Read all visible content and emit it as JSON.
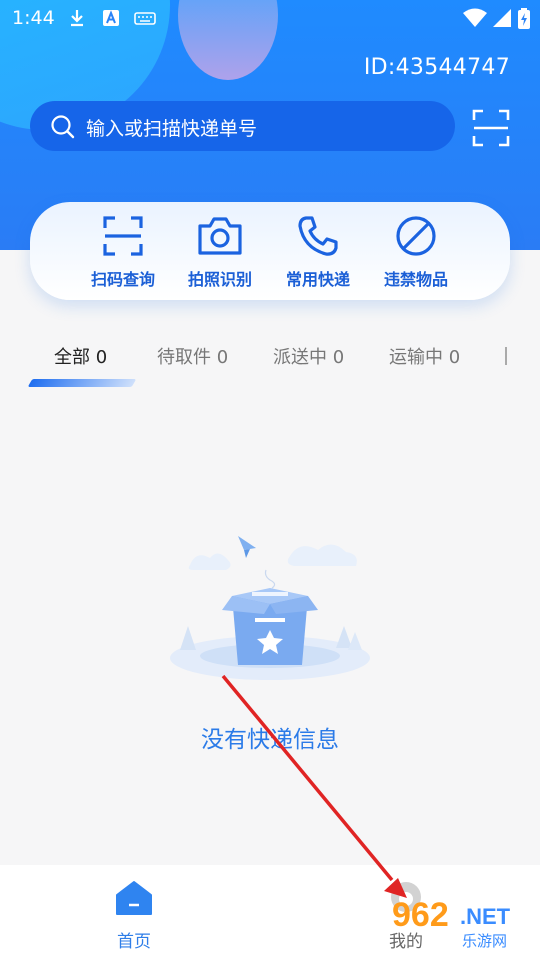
{
  "status": {
    "time": "1:44"
  },
  "header": {
    "user_id": "ID:43544747"
  },
  "search": {
    "placeholder": "输入或扫描快递单号"
  },
  "actions": [
    {
      "label": "扫码查询",
      "icon": "scan-icon"
    },
    {
      "label": "拍照识别",
      "icon": "camera-icon"
    },
    {
      "label": "常用快递",
      "icon": "phone-icon"
    },
    {
      "label": "违禁物品",
      "icon": "forbidden-icon"
    }
  ],
  "tabs": [
    {
      "label": "全部 0",
      "active": true
    },
    {
      "label": "待取件 0"
    },
    {
      "label": "派送中 0"
    },
    {
      "label": "运输中 0"
    }
  ],
  "empty": {
    "message": "没有快递信息"
  },
  "nav": {
    "home": "首页",
    "mine": "我的"
  },
  "watermark": {
    "brand": "962",
    "net": ".NET",
    "sub": "乐游网"
  },
  "colors": {
    "primary": "#1f8bff",
    "accent": "#2b7be8"
  }
}
